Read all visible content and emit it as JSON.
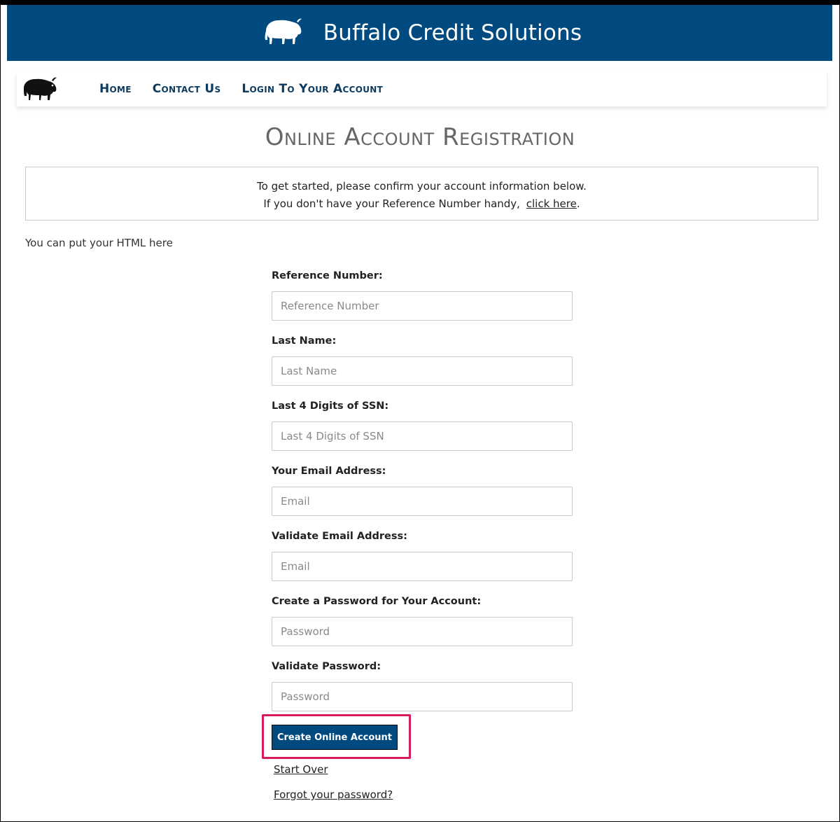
{
  "banner": {
    "brand_name": "Buffalo Credit Solutions",
    "logo_icon": "buffalo-icon",
    "background": "#014a7f"
  },
  "nav": {
    "logo_icon": "buffalo-icon",
    "items": [
      {
        "label": "Home"
      },
      {
        "label": "Contact Us"
      },
      {
        "label": "Login To Your Account"
      }
    ]
  },
  "page": {
    "title": "Online Account Registration",
    "info_line1": "To get started, please confirm your account information below.",
    "info_line2": "If you don't have your Reference Number handy,",
    "info_link": "click here",
    "info_suffix": ".",
    "html_placeholder": "You can put your HTML here"
  },
  "form": {
    "fields": [
      {
        "label": "Reference Number:",
        "placeholder": "Reference Number",
        "value": ""
      },
      {
        "label": "Last Name:",
        "placeholder": "Last Name",
        "value": ""
      },
      {
        "label": "Last 4 Digits of SSN:",
        "placeholder": "Last 4 Digits of SSN",
        "value": ""
      },
      {
        "label": "Your Email Address:",
        "placeholder": "Email",
        "value": ""
      },
      {
        "label": "Validate Email Address:",
        "placeholder": "Email",
        "value": ""
      },
      {
        "label": "Create a Password for Your Account:",
        "placeholder": "Password",
        "value": ""
      },
      {
        "label": "Validate Password:",
        "placeholder": "Password",
        "value": ""
      }
    ],
    "submit_label": "Create Online Account",
    "start_over": "Start Over",
    "forgot_password": "Forgot your password?"
  },
  "colors": {
    "brand": "#014a7f",
    "highlight": "#d81b5a"
  }
}
